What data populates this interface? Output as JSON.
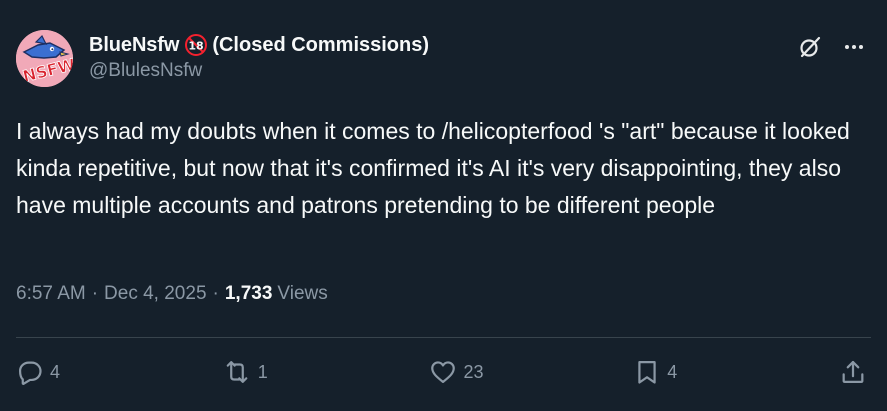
{
  "author": {
    "display_name": "BlueNsfw",
    "badge_text": "18",
    "name_suffix": "(Closed Commissions)",
    "handle": "@BlulesNsfw",
    "avatar_text": "NSFW"
  },
  "tweet": {
    "text": "I always had my doubts when it comes to /helicopterfood 's \"art\" because it looked kinda repetitive, but now that it's confirmed it's AI it's very disappointing, they also have multiple accounts and patrons pretending to be different people",
    "time": "6:57 AM",
    "separator": "·",
    "date": "Dec 4, 2025",
    "views_count": "1,733",
    "views_label": "Views"
  },
  "actions": {
    "replies": "4",
    "reposts": "1",
    "likes": "23",
    "bookmarks": "4"
  },
  "icons": {
    "top": [
      "grok-icon",
      "more-icon"
    ],
    "actions": [
      "reply-icon",
      "repost-icon",
      "like-icon",
      "bookmark-icon",
      "share-icon"
    ]
  },
  "colors": {
    "background": "#15202b",
    "text": "#f7f9f9",
    "secondary": "#8b98a5",
    "divider": "#38444d",
    "badge_red": "#f4212e",
    "avatar_pink": "#f1a9b8"
  }
}
